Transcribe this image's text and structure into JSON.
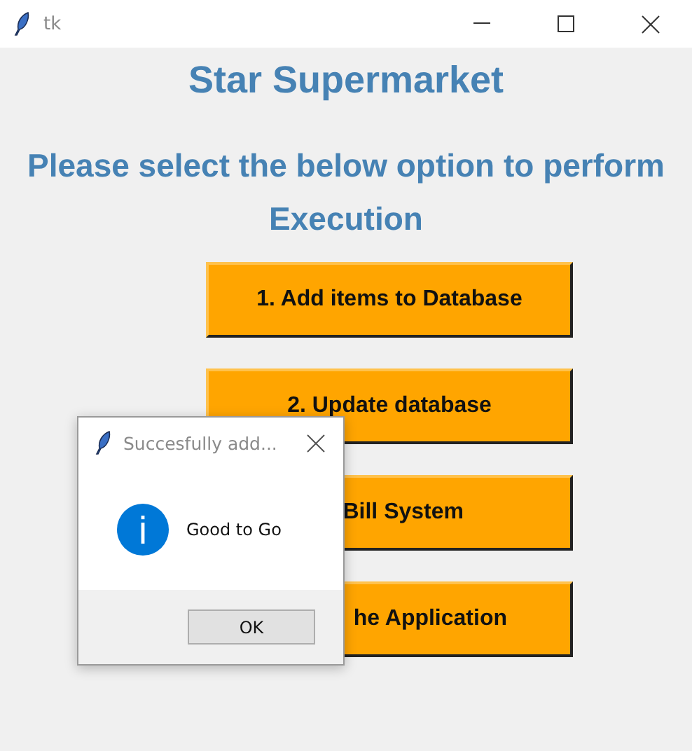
{
  "window": {
    "title": "tk"
  },
  "heading": "Star Supermarket",
  "prompt": "Please select the below option to perform Execution",
  "buttons": [
    {
      "label": "1. Add items to Database",
      "kind": "full"
    },
    {
      "label": "2. Update database",
      "kind": "full"
    },
    {
      "label": "Bill System",
      "kind": "partial"
    },
    {
      "label": "he Application",
      "kind": "partial"
    }
  ],
  "dialog": {
    "title": "Succesfully add...",
    "message": "Good to Go",
    "button": "OK"
  }
}
